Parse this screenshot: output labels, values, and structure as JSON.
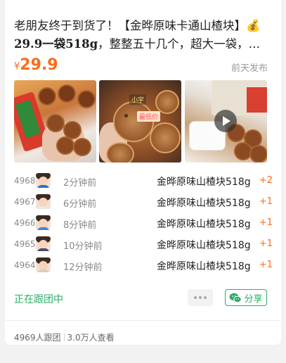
{
  "post": {
    "title_line1": "老朋友终于到货了！【金晔原味卡通山楂块】",
    "title_emoji": "💰",
    "title_line2_price": "29.9一袋518g",
    "title_line2_rest": "，整整五十几个，超大一袋，聚…",
    "currency": "¥",
    "price": "29.9",
    "posted_time": "前天发布"
  },
  "photos": {
    "p2_tag1": "小宇",
    "p2_tag2": "最低价"
  },
  "orders": [
    {
      "index": "4968",
      "time": "2分钟前",
      "product": "金晔原味山楂块518g",
      "qty": "+2",
      "shirt": "#2e6fc7"
    },
    {
      "index": "4967",
      "time": "6分钟前",
      "product": "金晔原味山楂块518g",
      "qty": "+1",
      "shirt": "#e7e7e7"
    },
    {
      "index": "4966",
      "time": "8分钟前",
      "product": "金晔原味山楂块518g",
      "qty": "+1",
      "shirt": "#3c8ad8"
    },
    {
      "index": "4965",
      "time": "10分钟前",
      "product": "金晔原味山楂块518g",
      "qty": "+1",
      "shirt": "#4b4b6a"
    },
    {
      "index": "4964",
      "time": "12分钟前",
      "product": "金晔原味山楂块518g",
      "qty": "+1",
      "shirt": "#d8cfc4"
    }
  ],
  "actions": {
    "following_label": "正在跟团中",
    "share_label": "分享"
  },
  "footer": {
    "joined": "4969人跟团",
    "views": "3.0万人查看"
  },
  "colors": {
    "accent_orange": "#ff6a1a",
    "accent_green": "#2aae67"
  },
  "icons": [
    "more-dots-icon",
    "wechat-icon",
    "play-icon"
  ]
}
